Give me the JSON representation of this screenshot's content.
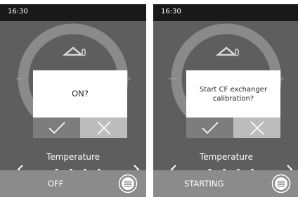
{
  "screens": [
    {
      "time": "16:30",
      "dialog": {
        "message": "ON?",
        "confirm_icon": "checkmark-icon",
        "cancel_icon": "close-icon"
      },
      "carousel": {
        "title": "Temperature",
        "page_count": 4,
        "current_page": 1
      },
      "footer": {
        "status": "OFF",
        "menu_icon": "menu-icon"
      }
    },
    {
      "time": "16:30",
      "dialog": {
        "message": "Start CF exchanger\ncalibration?",
        "confirm_icon": "checkmark-icon",
        "cancel_icon": "close-icon"
      },
      "carousel": {
        "title": "Temperature",
        "page_count": 4,
        "current_page": 1
      },
      "footer": {
        "status": "STARTING",
        "menu_icon": "menu-icon"
      }
    }
  ],
  "colors": {
    "status_bar": "#191919",
    "background": "#5e5e5e",
    "dial_ring": "#8a8a8a",
    "dialog_body": "#ffffff",
    "confirm_button": "#7d7d7d",
    "cancel_button": "#bcbcbc",
    "footer": "#8b8b8b"
  }
}
